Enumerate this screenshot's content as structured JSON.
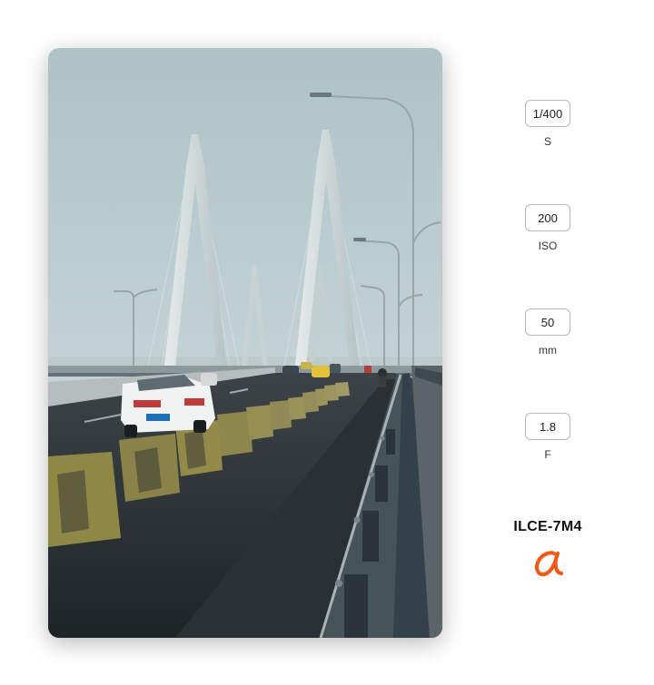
{
  "specs": [
    {
      "value": "1/400",
      "unit": "S"
    },
    {
      "value": "200",
      "unit": "ISO"
    },
    {
      "value": "50",
      "unit": "mm"
    },
    {
      "value": "1.8",
      "unit": "F"
    }
  ],
  "camera": {
    "model": "ILCE-7M4",
    "logo_icon": "sony-alpha-logo-icon",
    "logo_color": "#f05a1a"
  },
  "photo": {
    "subject": "cable-stayed-bridge-with-traffic-photo"
  }
}
